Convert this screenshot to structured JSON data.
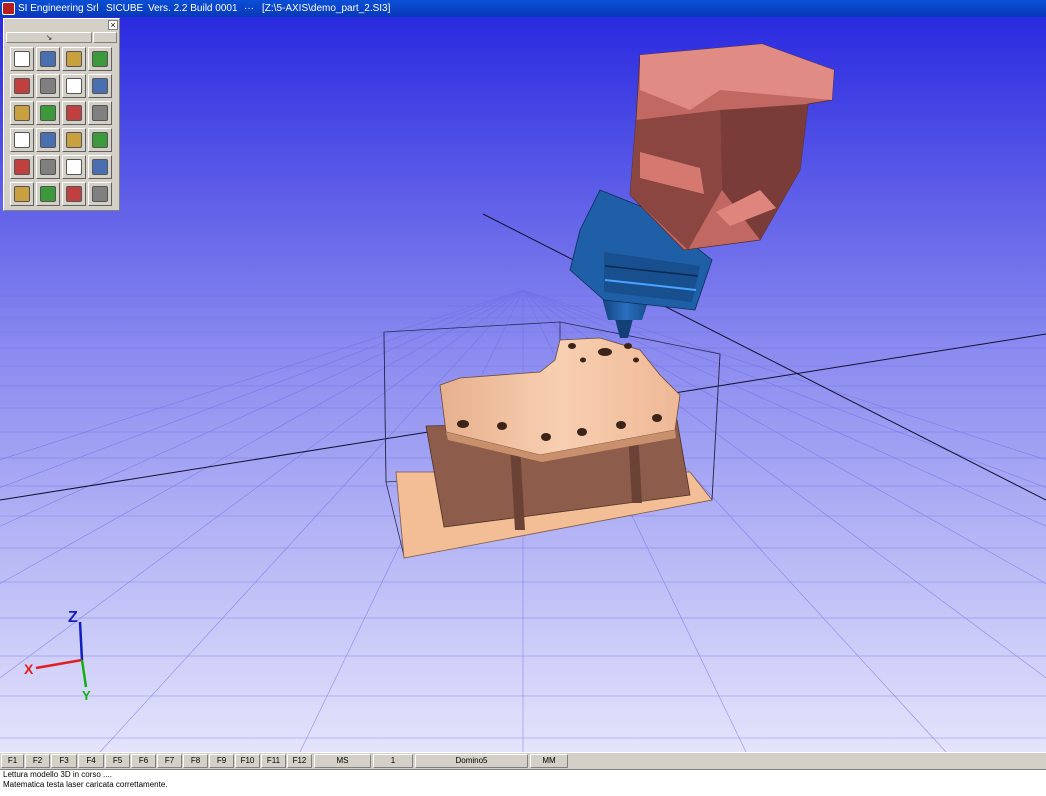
{
  "titlebar": {
    "company": "SI Engineering Srl",
    "app_name": "SICUBE",
    "version": "Vers. 2.2 Build 0001",
    "separator": "···",
    "file_path": "[Z:\\5-AXIS\\demo_part_2.SI3]"
  },
  "toolbox": {
    "close_label": "×",
    "tab_label": "↘",
    "tool_icons": [
      "new-file-icon",
      "save-icon",
      "save-as-icon",
      "print-setup-icon",
      "box-view-icon",
      "move-icon",
      "trajectory-icon",
      "zoom-icon",
      "globe-icon",
      "machine-icon",
      "tool-edit-icon",
      "drawer-icon",
      "laser-warning-icon",
      "camera-view-icon",
      "edit-pen-icon",
      "grid-palette-icon",
      "help-icon",
      "tool-path-icon",
      "list-icon",
      "column-icon",
      "book-icon",
      "undo-icon",
      "cd-icon",
      "exit-icon"
    ]
  },
  "function_keys": [
    "F1",
    "F2",
    "F3",
    "F4",
    "F5",
    "F6",
    "F7",
    "F8",
    "F9",
    "F10",
    "F11",
    "F12"
  ],
  "status": {
    "mode": "MS",
    "index": "1",
    "profile": "Domino5",
    "units": "MM"
  },
  "messages": [
    "Lettura modello 3D in corso ....",
    "Matematica testa laser caricata correttamente."
  ],
  "colors": {
    "sky_top": "#2a2ae0",
    "sky_bottom": "#dedefa",
    "part": "#f5c19d",
    "head": "#c96a63",
    "spindle": "#1f5fa7"
  },
  "axes": {
    "z": "Z",
    "x": "X",
    "y": "Y"
  }
}
